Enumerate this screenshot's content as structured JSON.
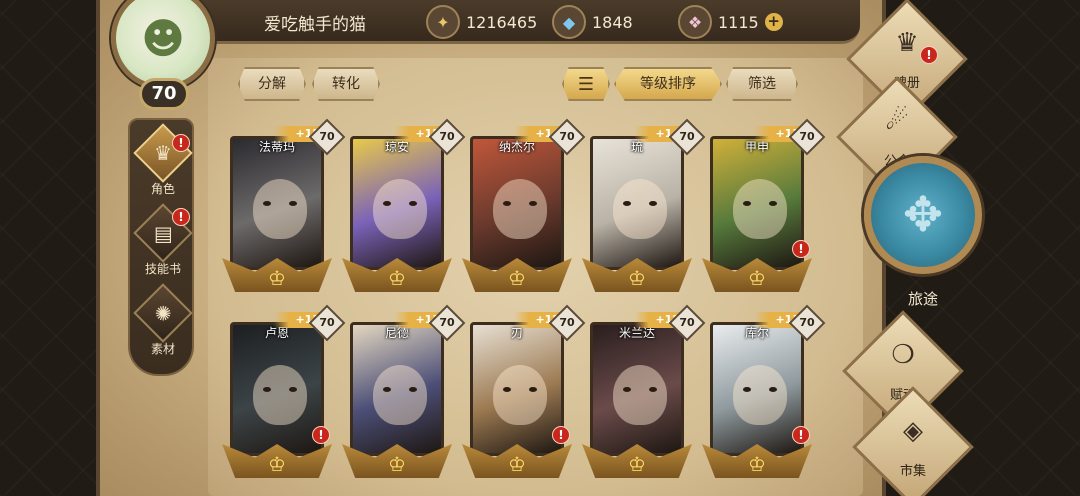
{
  "player": {
    "name": "爱吃触手的猫",
    "level": "70",
    "avatar_icon": "radish-mascot-icon"
  },
  "resources": [
    {
      "icon": "gold-coin-icon",
      "value": "1216465",
      "glyph": "✦"
    },
    {
      "icon": "blue-crystal-icon",
      "value": "1848",
      "glyph": "◆"
    },
    {
      "icon": "pink-gem-icon",
      "value": "1115",
      "glyph": "❖"
    }
  ],
  "resource_plus": "+",
  "left_nav": [
    {
      "label": "角色",
      "icon": "character-icon",
      "glyph": "♛",
      "alert": "!"
    },
    {
      "label": "技能书",
      "icon": "skill-book-icon",
      "glyph": "▤",
      "alert": "!"
    },
    {
      "label": "素材",
      "icon": "material-icon",
      "glyph": "✺",
      "alert": ""
    }
  ],
  "actions": {
    "decompose": "分解",
    "convert": "转化",
    "sort_level": "等级排序",
    "filter": "筛选",
    "sort_icon": "sort-icon"
  },
  "heroes": [
    {
      "name": "法蒂玛",
      "plus": "+15",
      "level": "70",
      "alert": false,
      "bg": "#6d6a6a",
      "accent": "#2b2a2e"
    },
    {
      "name": "琼安",
      "plus": "+15",
      "level": "70",
      "alert": false,
      "bg": "#7a62b8",
      "accent": "#e8c94a"
    },
    {
      "name": "纳杰尔",
      "plus": "+14",
      "level": "70",
      "alert": false,
      "bg": "#6b3a2d",
      "accent": "#c0573a"
    },
    {
      "name": "琉",
      "plus": "+14",
      "level": "70",
      "alert": false,
      "bg": "#b9b2a6",
      "accent": "#e8e3d9"
    },
    {
      "name": "甲申",
      "plus": "+13",
      "level": "70",
      "alert": true,
      "bg": "#577a3c",
      "accent": "#d0b03a"
    },
    {
      "name": "卢恩",
      "plus": "+13",
      "level": "70",
      "alert": true,
      "bg": "#3c4447",
      "accent": "#1d1f22"
    },
    {
      "name": "尼德",
      "plus": "+13",
      "level": "70",
      "alert": false,
      "bg": "#4d4f78",
      "accent": "#e3d7c0"
    },
    {
      "name": "刃",
      "plus": "+12",
      "level": "70",
      "alert": true,
      "bg": "#9c7a52",
      "accent": "#e7dfd3"
    },
    {
      "name": "米兰达",
      "plus": "+12",
      "level": "70",
      "alert": false,
      "bg": "#6a4b4a",
      "accent": "#2a1e1e"
    },
    {
      "name": "库尔",
      "plus": "+11",
      "level": "70",
      "alert": true,
      "bg": "#8f9a9e",
      "accent": "#e9ecee"
    }
  ],
  "right_menu": [
    {
      "label": "魂册",
      "icon": "soul-book-icon",
      "glyph": "♛",
      "alert": "!"
    },
    {
      "label": "公会",
      "icon": "guild-icon",
      "glyph": "☄",
      "alert": ""
    },
    {
      "label": "赋魂",
      "icon": "soul-infuse-icon",
      "glyph": "❍",
      "alert": ""
    },
    {
      "label": "市集",
      "icon": "market-icon",
      "glyph": "◈",
      "alert": ""
    }
  ],
  "journey": {
    "label": "旅途",
    "icon": "journey-emblem-icon",
    "glyph": "✥"
  },
  "crest_glyph": "♔"
}
